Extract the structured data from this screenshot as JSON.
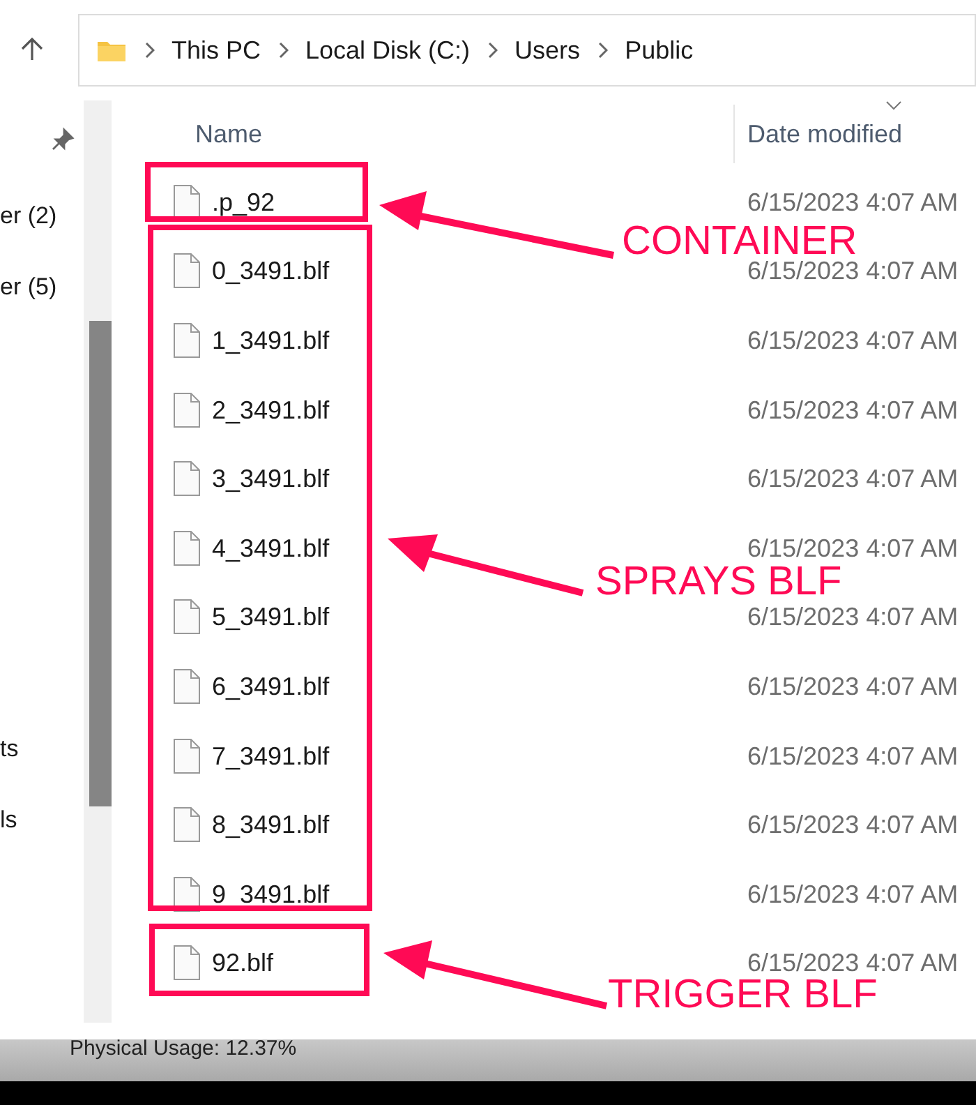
{
  "breadcrumb": [
    "This PC",
    "Local Disk (C:)",
    "Users",
    "Public"
  ],
  "nav_pane": {
    "items": [
      {
        "label": "er (2)"
      },
      {
        "label": "er (5)"
      },
      {
        "label": "ts"
      },
      {
        "label": "ls"
      }
    ]
  },
  "columns": [
    "Name",
    "Date modified"
  ],
  "files": [
    {
      "name": ".p_92",
      "date": "6/15/2023 4:07 AM"
    },
    {
      "name": "0_3491.blf",
      "date": "6/15/2023 4:07 AM"
    },
    {
      "name": "1_3491.blf",
      "date": "6/15/2023 4:07 AM"
    },
    {
      "name": "2_3491.blf",
      "date": "6/15/2023 4:07 AM"
    },
    {
      "name": "3_3491.blf",
      "date": "6/15/2023 4:07 AM"
    },
    {
      "name": "4_3491.blf",
      "date": "6/15/2023 4:07 AM"
    },
    {
      "name": "5_3491.blf",
      "date": "6/15/2023 4:07 AM"
    },
    {
      "name": "6_3491.blf",
      "date": "6/15/2023 4:07 AM"
    },
    {
      "name": "7_3491.blf",
      "date": "6/15/2023 4:07 AM"
    },
    {
      "name": "8_3491.blf",
      "date": "6/15/2023 4:07 AM"
    },
    {
      "name": "9_3491.blf",
      "date": "6/15/2023 4:07 AM"
    },
    {
      "name": "92.blf",
      "date": "6/15/2023 4:07 AM"
    }
  ],
  "annotations": [
    {
      "label": "CONTAINER"
    },
    {
      "label": "SPRAYS BLF"
    },
    {
      "label": "TRIGGER BLF"
    }
  ],
  "status_bar": {
    "text": "Physical Usage: 12.37%"
  }
}
